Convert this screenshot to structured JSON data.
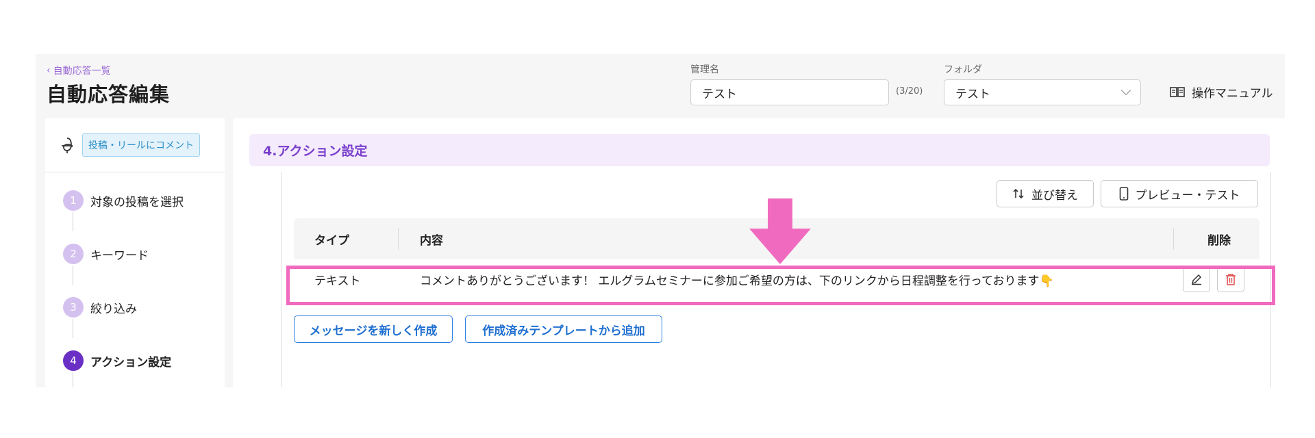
{
  "header": {
    "back_link": "自動応答一覧",
    "title": "自動応答編集",
    "name_label": "管理名",
    "name_value": "テスト",
    "name_counter": "(3/20)",
    "folder_label": "フォルダ",
    "folder_value": "テスト",
    "manual_label": "操作マニュアル"
  },
  "sidebar": {
    "trigger_badge": "投稿・リールにコメント",
    "steps": [
      {
        "num": "1",
        "label": "対象の投稿を選択"
      },
      {
        "num": "2",
        "label": "キーワード"
      },
      {
        "num": "3",
        "label": "絞り込み"
      },
      {
        "num": "4",
        "label": "アクション設定"
      }
    ]
  },
  "main": {
    "section_title": "4.アクション設定",
    "sort_label": "並び替え",
    "preview_label": "プレビュー・テスト",
    "table": {
      "headers": {
        "type": "タイプ",
        "content": "内容",
        "delete": "削除"
      },
      "rows": [
        {
          "type": "テキスト",
          "content": "コメントありがとうございます！ エルグラムセミナーに参加ご希望の方は、下のリンクから日程調整を行っております👇"
        }
      ]
    },
    "new_message_label": "メッセージを新しく作成",
    "add_template_label": "作成済みテンプレートから追加"
  },
  "colors": {
    "accent_purple": "#7a3fcc",
    "annotation_pink": "#f06bbf",
    "link_blue": "#1f6fd0",
    "delete_red": "#e04848"
  }
}
